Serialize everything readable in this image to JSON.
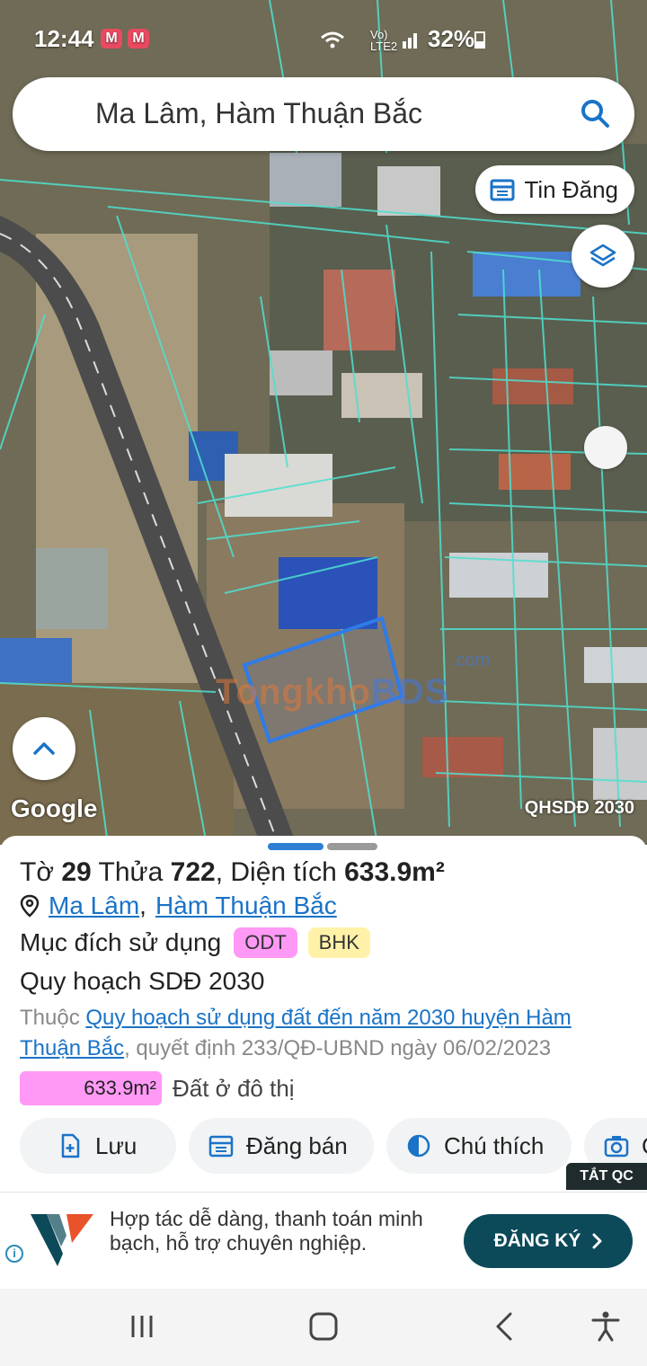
{
  "status_bar": {
    "time": "12:44",
    "app_badges": [
      "M",
      "M"
    ],
    "network": "Vo) LTE2",
    "battery": "32%"
  },
  "search": {
    "query": "Ma Lâm, Hàm Thuận Bắc",
    "icon": "search-icon"
  },
  "map": {
    "listings_button": "Tin Đăng",
    "attribution": "Google",
    "layer_badge": "QHSDĐ 2030",
    "watermark": {
      "part1": "Tongkho",
      "part2": "BDS",
      "suffix": ".com"
    }
  },
  "parcel": {
    "sheet_prefix": "Tờ",
    "sheet_no": "29",
    "lot_prefix": "Thửa",
    "lot_no": "722",
    "area_prefix": ", Diện tích",
    "area": "633.9m²",
    "commune": "Ma Lâm",
    "district": "Hàm Thuận Bắc",
    "purpose_label": "Mục đích sử dụng",
    "purpose_tags": [
      "ODT",
      "BHK"
    ],
    "plan_label": "Quy hoạch SDĐ 2030",
    "plan_prefix": "Thuộc",
    "plan_link": "Quy hoạch sử dụng đất đến năm 2030 huyện Hàm Thuận Bắc",
    "plan_suffix": ", quyết định 233/QĐ-UBND ngày 06/02/2023",
    "area_chip": "633.9m²",
    "area_chip_label": "Đất ở đô thị"
  },
  "actions": [
    {
      "label": "Lưu",
      "icon": "add-file-icon"
    },
    {
      "label": "Đăng bán",
      "icon": "calendar-icon"
    },
    {
      "label": "Chú thích",
      "icon": "contrast-icon"
    },
    {
      "label": "C",
      "icon": "camera-icon"
    }
  ],
  "ad": {
    "close_label": "TẮT QC",
    "text": "Hợp tác dễ dàng, thanh toán minh bạch, hỗ trợ chuyên nghiệp.",
    "cta": "ĐĂNG KÝ"
  },
  "colors": {
    "accent": "#1a73c7",
    "odt_tag": "#ff99f5",
    "bhk_tag": "#fff2a8",
    "ad_button": "#0c4a5a",
    "parcel_lines": "#4fe0d0"
  }
}
